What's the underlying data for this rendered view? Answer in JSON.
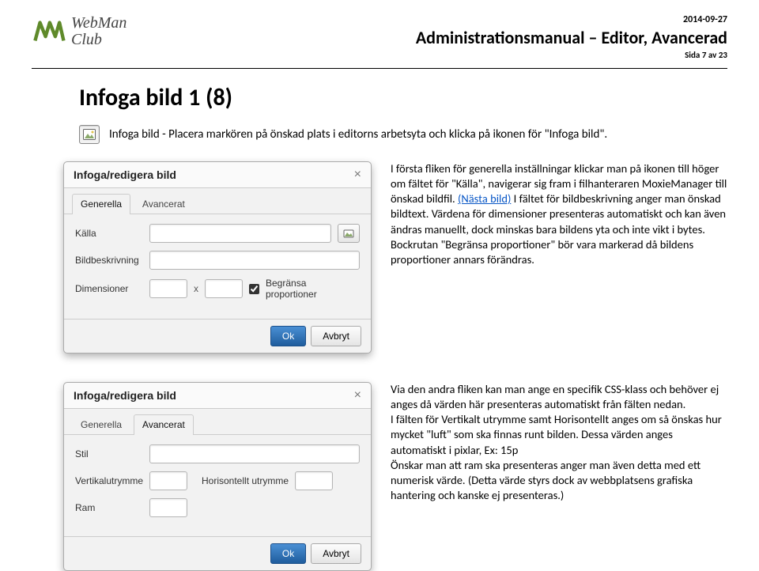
{
  "header": {
    "logo_line1": "WebMan",
    "logo_line2": "Club",
    "date": "2014-09-27",
    "doc_title": "Administrationsmanual – Editor, Avancerad",
    "page_of": "Sida 7 av 23"
  },
  "page_title": "Infoga bild 1 (8)",
  "intro_text": "Infoga bild - Placera markören på önskad plats i editorns arbetsyta och klicka på ikonen för \"Infoga bild\".",
  "dialog1": {
    "title": "Infoga/redigera bild",
    "tabs": {
      "general": "Generella",
      "advanced": "Avancerat"
    },
    "labels": {
      "source": "Källa",
      "desc": "Bildbeskrivning",
      "dims": "Dimensioner",
      "x": "x",
      "constrain": "Begränsa proportioner"
    },
    "buttons": {
      "ok": "Ok",
      "cancel": "Avbryt"
    }
  },
  "desc1_a": "I första fliken för generella inställningar klickar man på ikonen till höger om fältet för \"Källa\", navigerar sig fram i filhanteraren MoxieManager till önskad bildfil. ",
  "desc1_link": "(Nästa bild)",
  "desc1_b": " I fältet för bildbeskrivning anger man önskad bildtext. Värdena för dimensioner presenteras automatiskt och kan även ändras manuellt, dock minskas bara bildens yta och inte vikt i bytes. Bockrutan \"Begränsa proportioner\" bör vara markerad då bildens proportioner annars förändras.",
  "dialog2": {
    "title": "Infoga/redigera bild",
    "tabs": {
      "general": "Generella",
      "advanced": "Avancerat"
    },
    "labels": {
      "style": "Stil",
      "vspace": "Vertikalutrymme",
      "hspace": "Horisontellt utrymme",
      "border": "Ram"
    },
    "buttons": {
      "ok": "Ok",
      "cancel": "Avbryt"
    }
  },
  "desc2": "Via den andra fliken kan man ange en specifik CSS-klass och behöver ej anges då värden här presenteras automatiskt från fälten nedan.\nI fälten för Vertikalt utrymme samt Horisontellt anges om så önskas hur mycket \"luft\" som ska finnas runt bilden. Dessa värden anges automatiskt i pixlar, Ex: 15p\nÖnskar man att ram ska presenteras anger man även detta med ett numerisk värde. (Detta värde styrs dock av webbplatsens grafiska hantering och kanske ej presenteras.)"
}
